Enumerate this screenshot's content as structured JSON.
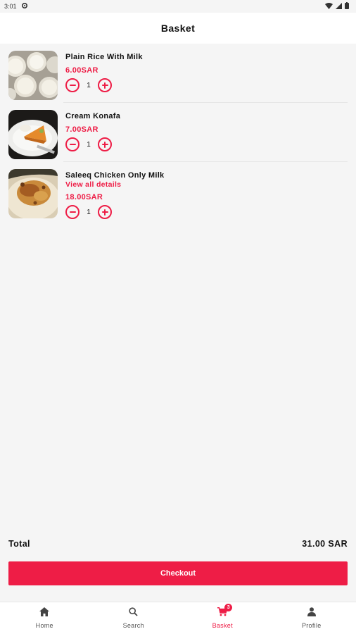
{
  "status_bar": {
    "time": "3:01"
  },
  "header": {
    "title": "Basket"
  },
  "items": [
    {
      "name": "Plain Rice With Milk",
      "details_link": "",
      "price": "6.00SAR",
      "quantity": "1"
    },
    {
      "name": "Cream Konafa",
      "details_link": "",
      "price": "7.00SAR",
      "quantity": "1"
    },
    {
      "name": "Saleeq Chicken Only Milk",
      "details_link": "View all details",
      "price": "18.00SAR",
      "quantity": "1"
    }
  ],
  "summary": {
    "total_label": "Total",
    "total_value": "31.00 SAR"
  },
  "checkout": {
    "label": "Checkout"
  },
  "bottom_nav": {
    "items": [
      {
        "label": "Home",
        "icon": "home-icon"
      },
      {
        "label": "Search",
        "icon": "search-icon"
      },
      {
        "label": "Basket",
        "icon": "cart-icon",
        "badge": "3",
        "active": true
      },
      {
        "label": "Profile",
        "icon": "person-icon"
      }
    ]
  },
  "colors": {
    "accent": "#ee1d46",
    "background": "#f5f5f5"
  }
}
